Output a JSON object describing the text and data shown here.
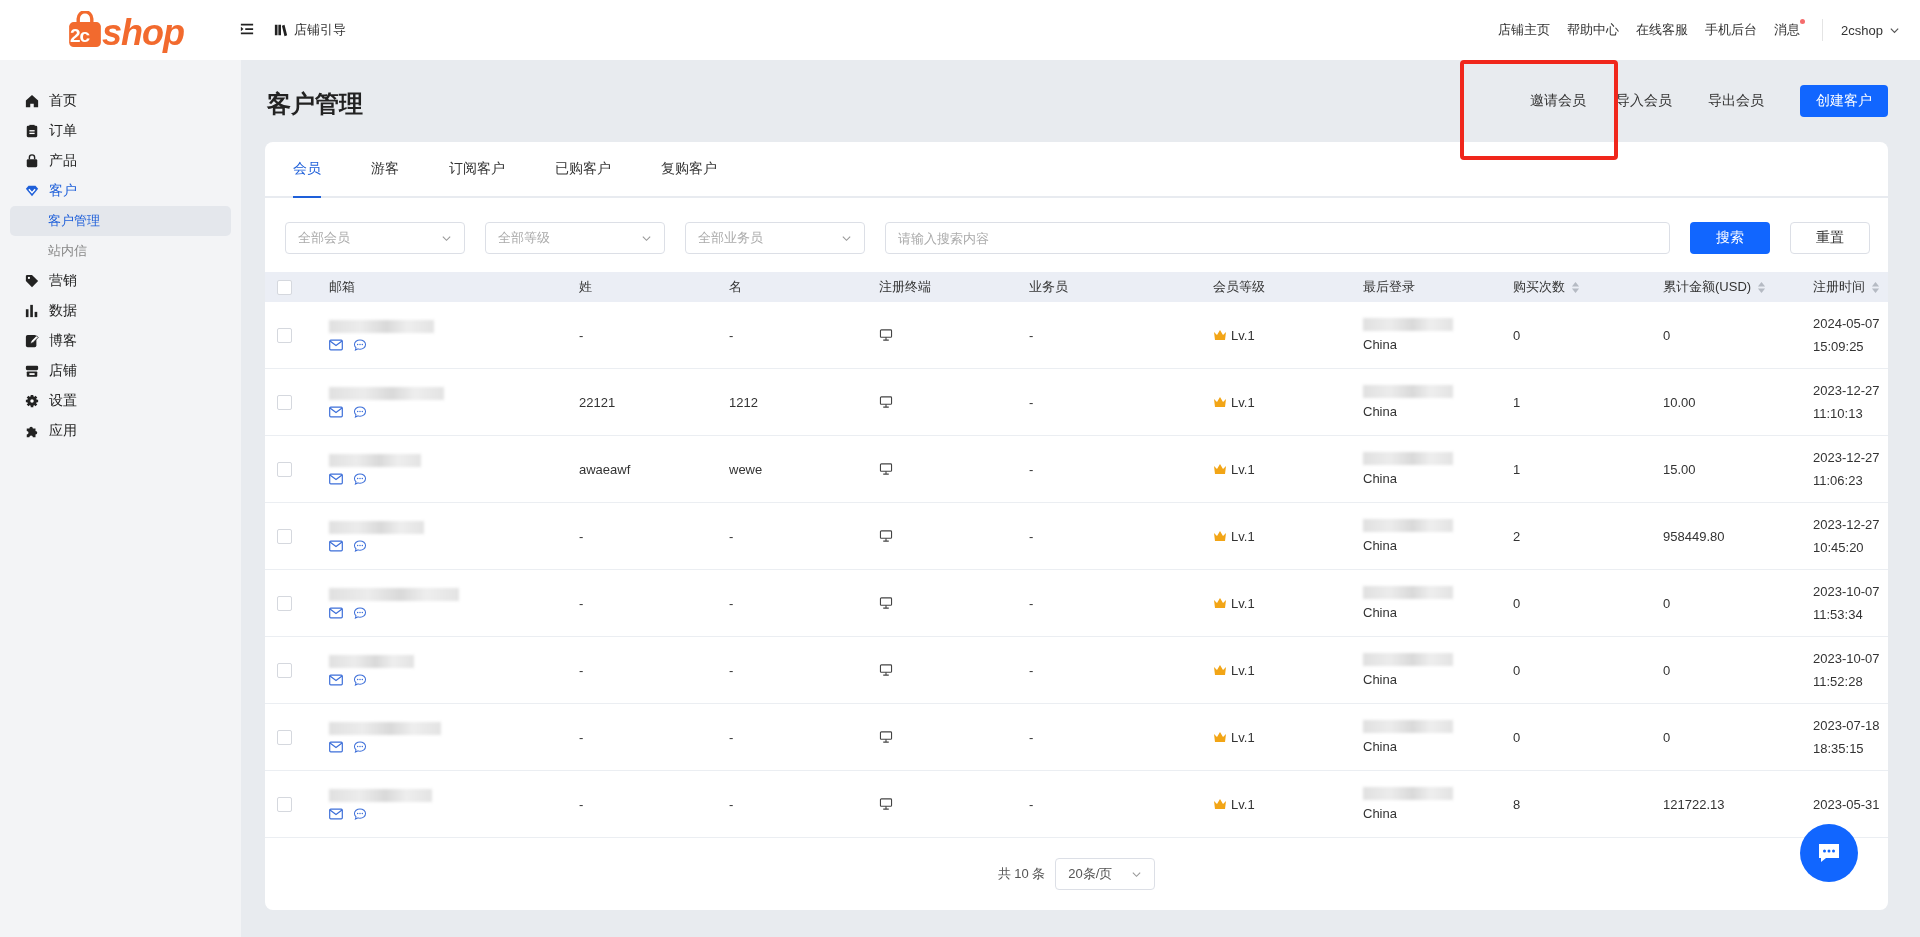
{
  "header": {
    "logo": {
      "mark": "2c",
      "text": "shop"
    },
    "guide": "店铺引导",
    "links": [
      {
        "label": "店铺主页",
        "dot": false
      },
      {
        "label": "帮助中心",
        "dot": false
      },
      {
        "label": "在线客服",
        "dot": false
      },
      {
        "label": "手机后台",
        "dot": false
      },
      {
        "label": "消息",
        "dot": true
      }
    ],
    "user": "2cshop"
  },
  "sidebar": {
    "items": [
      {
        "label": "首页",
        "selected": false
      },
      {
        "label": "订单",
        "selected": false
      },
      {
        "label": "产品",
        "selected": false
      },
      {
        "label": "客户",
        "selected": true,
        "children": [
          {
            "label": "客户管理",
            "selected": true
          },
          {
            "label": "站内信",
            "selected": false
          }
        ]
      },
      {
        "label": "营销",
        "selected": false
      },
      {
        "label": "数据",
        "selected": false
      },
      {
        "label": "博客",
        "selected": false
      },
      {
        "label": "店铺",
        "selected": false
      },
      {
        "label": "设置",
        "selected": false
      },
      {
        "label": "应用",
        "selected": false
      }
    ]
  },
  "page": {
    "title": "客户管理",
    "actions": [
      {
        "label": "邀请会员",
        "kind": "link"
      },
      {
        "label": "导入会员",
        "kind": "link"
      },
      {
        "label": "导出会员",
        "kind": "link"
      },
      {
        "label": "创建客户",
        "kind": "primary"
      }
    ]
  },
  "tabs": [
    {
      "label": "会员",
      "selected": true
    },
    {
      "label": "游客",
      "selected": false
    },
    {
      "label": "订阅客户",
      "selected": false
    },
    {
      "label": "已购客户",
      "selected": false
    },
    {
      "label": "复购客户",
      "selected": false
    }
  ],
  "filters": {
    "selects": [
      {
        "placeholder": "全部会员"
      },
      {
        "placeholder": "全部等级"
      },
      {
        "placeholder": "全部业务员"
      }
    ],
    "search": {
      "placeholder": "请输入搜索内容"
    },
    "search_button": "搜索",
    "reset_button": "重置"
  },
  "table": {
    "select_all": {
      "checked": false
    },
    "columns": [
      {
        "label": "邮箱",
        "sortable": false
      },
      {
        "label": "姓",
        "sortable": false
      },
      {
        "label": "名",
        "sortable": false
      },
      {
        "label": "注册终端",
        "sortable": false
      },
      {
        "label": "业务员",
        "sortable": false
      },
      {
        "label": "会员等级",
        "sortable": false
      },
      {
        "label": "最后登录",
        "sortable": false
      },
      {
        "label": "购买次数",
        "sortable": true
      },
      {
        "label": "累计金额(USD)",
        "sortable": true
      },
      {
        "label": "注册时间",
        "sortable": true
      }
    ],
    "rows": [
      {
        "checked": false,
        "last_name": "-",
        "first_name": "-",
        "salesperson": "-",
        "level": "Lv.1",
        "country": "China",
        "purchases": "0",
        "total": "0",
        "registered": [
          "2024-05-07",
          "15:09:25"
        ]
      },
      {
        "checked": false,
        "last_name": "22121",
        "first_name": "1212",
        "salesperson": "-",
        "level": "Lv.1",
        "country": "China",
        "purchases": "1",
        "total": "10.00",
        "registered": [
          "2023-12-27",
          "11:10:13"
        ]
      },
      {
        "checked": false,
        "last_name": "awaeawf",
        "first_name": "wewe",
        "salesperson": "-",
        "level": "Lv.1",
        "country": "China",
        "purchases": "1",
        "total": "15.00",
        "registered": [
          "2023-12-27",
          "11:06:23"
        ]
      },
      {
        "checked": false,
        "last_name": "-",
        "first_name": "-",
        "salesperson": "-",
        "level": "Lv.1",
        "country": "China",
        "purchases": "2",
        "total": "958449.80",
        "registered": [
          "2023-12-27",
          "10:45:20"
        ]
      },
      {
        "checked": false,
        "last_name": "-",
        "first_name": "-",
        "salesperson": "-",
        "level": "Lv.1",
        "country": "China",
        "purchases": "0",
        "total": "0",
        "registered": [
          "2023-10-07",
          "11:53:34"
        ]
      },
      {
        "checked": false,
        "last_name": "-",
        "first_name": "-",
        "salesperson": "-",
        "level": "Lv.1",
        "country": "China",
        "purchases": "0",
        "total": "0",
        "registered": [
          "2023-10-07",
          "11:52:28"
        ]
      },
      {
        "checked": false,
        "last_name": "-",
        "first_name": "-",
        "salesperson": "-",
        "level": "Lv.1",
        "country": "China",
        "purchases": "0",
        "total": "0",
        "registered": [
          "2023-07-18",
          "18:35:15"
        ]
      },
      {
        "checked": false,
        "last_name": "-",
        "first_name": "-",
        "salesperson": "-",
        "level": "Lv.1",
        "country": "China",
        "purchases": "8",
        "total": "121722.13",
        "registered": [
          "2023-05-31"
        ]
      }
    ]
  },
  "pagination": {
    "total": "共 10 条",
    "page_size": "20条/页"
  }
}
